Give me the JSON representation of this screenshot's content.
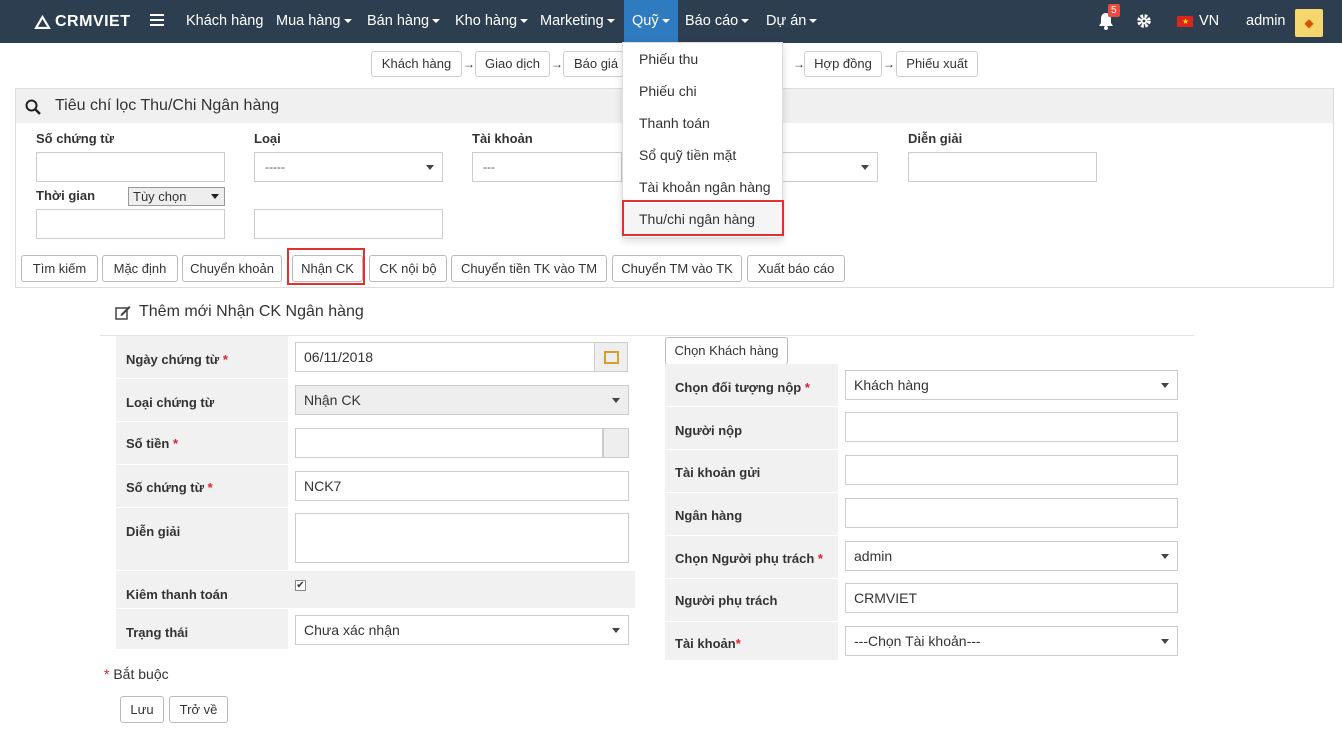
{
  "navbar": {
    "brand": "CRMVIET",
    "items": [
      {
        "label": "Khách hàng",
        "has_caret": false
      },
      {
        "label": "Mua hàng",
        "has_caret": true
      },
      {
        "label": "Bán hàng",
        "has_caret": true
      },
      {
        "label": "Kho hàng",
        "has_caret": true
      },
      {
        "label": "Marketing",
        "has_caret": true
      },
      {
        "label": "Quỹ",
        "has_caret": true,
        "active": true
      },
      {
        "label": "Báo cáo",
        "has_caret": true
      },
      {
        "label": "Dự án",
        "has_caret": true
      }
    ],
    "notification_count": "5",
    "language": "VN",
    "user": "admin",
    "colors": {
      "bar": "#2c3e50",
      "active": "#2f7bbf"
    }
  },
  "quy_menu": {
    "items": [
      "Phiếu thu",
      "Phiếu chi",
      "Thanh toán",
      "Sổ quỹ tiền mặt",
      "Tài khoản ngân hàng",
      "Thu/chi ngân hàng"
    ],
    "highlighted": "Thu/chi ngân hàng"
  },
  "breadcrumb": {
    "steps": [
      "Khách hàng",
      "Giao dịch",
      "Báo giá",
      "Hợp đồng",
      "Phiếu xuất"
    ],
    "arrow": "→"
  },
  "filter": {
    "title": "Tiêu chí lọc Thu/Chi Ngân hàng",
    "fields": {
      "so_chung_tu": "Số chứng từ",
      "loai": "Loại",
      "loai_value": "-----",
      "tai_khoan": "Tài khoản",
      "tai_khoan_value": "---",
      "dien_giai": "Diễn giải",
      "thoi_gian": "Thời gian",
      "thoi_gian_option": "Tùy chọn"
    },
    "buttons": [
      "Tìm kiếm",
      "Mặc định",
      "Chuyển khoản",
      "Nhận CK",
      "CK nội bộ",
      "Chuyển tiền TK vào TM",
      "Chuyển TM vào TK",
      "Xuất báo cáo"
    ],
    "highlighted_button": "Nhận CK"
  },
  "form": {
    "title": "Thêm mới Nhận CK Ngân hàng",
    "left": {
      "ngay_chung_tu": {
        "label": "Ngày chứng từ",
        "value": "06/11/2018"
      },
      "loai_chung_tu": {
        "label": "Loại chứng từ",
        "value": "Nhận CK"
      },
      "so_tien": {
        "label": "Số tiền",
        "value": ""
      },
      "so_chung_tu": {
        "label": "Số chứng từ",
        "value": "NCK7"
      },
      "dien_giai": {
        "label": "Diễn giải",
        "value": ""
      },
      "kiem_thanh_toan": {
        "label": "Kiêm thanh toán",
        "checked": true,
        "mark": "✔"
      },
      "trang_thai": {
        "label": "Trạng thái",
        "value": "Chưa xác nhận"
      }
    },
    "right": {
      "chon_khach_hang_button": "Chọn Khách hàng",
      "doi_tuong_nop": {
        "label": "Chọn đối tượng nộp",
        "value": "Khách hàng"
      },
      "nguoi_nop": {
        "label": "Người nộp",
        "value": ""
      },
      "tai_khoan_gui": {
        "label": "Tài khoản gửi",
        "value": ""
      },
      "ngan_hang": {
        "label": "Ngân hàng",
        "value": ""
      },
      "nguoi_phu_trach_select": {
        "label": "Chọn Người phụ trách",
        "value": "admin"
      },
      "nguoi_phu_trach": {
        "label": "Người phụ trách",
        "value": "CRMVIET"
      },
      "tai_khoan": {
        "label": "Tài khoản",
        "value": "---Chọn Tài khoản---"
      }
    },
    "required_mark": "*",
    "required_note": "Bắt buộc",
    "save_label": "Lưu",
    "back_label": "Trở về"
  }
}
